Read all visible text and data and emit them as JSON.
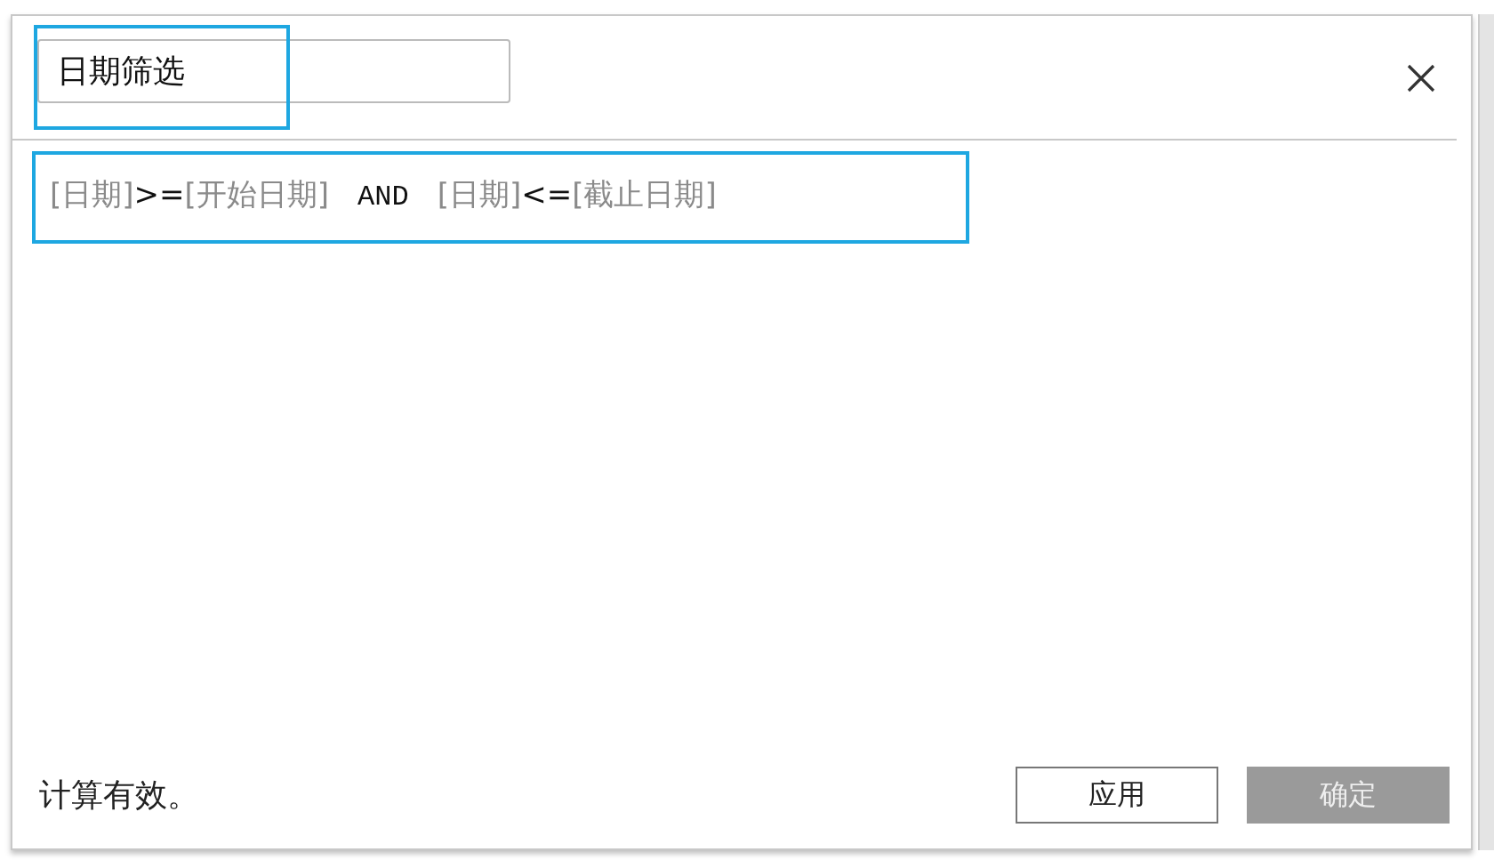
{
  "title_field": {
    "value": "日期筛选",
    "highlighted": true
  },
  "formula": {
    "highlighted": true,
    "tokens": [
      {
        "kind": "field",
        "text": "[日期]"
      },
      {
        "kind": "operator",
        "text": ">="
      },
      {
        "kind": "field",
        "text": "[开始日期]"
      },
      {
        "kind": "keyword",
        "text": "AND"
      },
      {
        "kind": "field",
        "text": "[日期]"
      },
      {
        "kind": "operator",
        "text": "<="
      },
      {
        "kind": "field",
        "text": "[截止日期]"
      }
    ]
  },
  "status": "计算有效。",
  "buttons": [
    {
      "label": "应用",
      "disabled": false
    },
    {
      "label": "确定",
      "disabled": true
    }
  ]
}
